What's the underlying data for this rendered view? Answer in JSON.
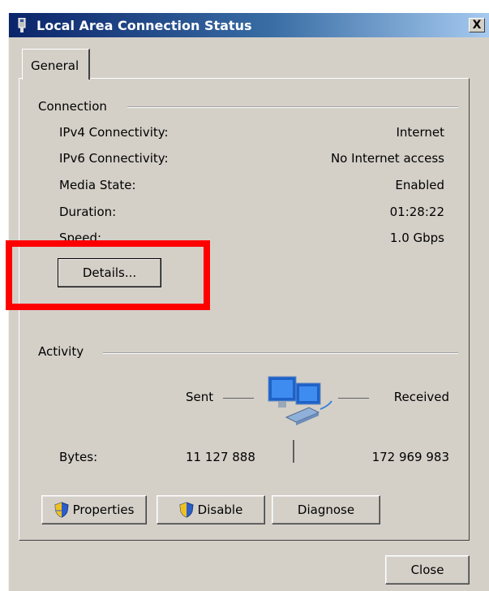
{
  "window": {
    "title": "Local Area Connection Status",
    "close_glyph": "X"
  },
  "tabs": [
    {
      "label": "General",
      "selected": true
    }
  ],
  "connection": {
    "group_label": "Connection",
    "rows": [
      {
        "label": "IPv4 Connectivity:",
        "value": "Internet"
      },
      {
        "label": "IPv6 Connectivity:",
        "value": "No Internet access"
      },
      {
        "label": "Media State:",
        "value": "Enabled"
      },
      {
        "label": "Duration:",
        "value": "01:28:22"
      },
      {
        "label": "Speed:",
        "value": "1.0 Gbps"
      }
    ],
    "details_button": "Details..."
  },
  "activity": {
    "group_label": "Activity",
    "sent_label": "Sent",
    "received_label": "Received",
    "bytes_label": "Bytes:",
    "bytes_sent": "11 127 888",
    "bytes_received": "172 969 983",
    "network_icon": "network-computers-icon"
  },
  "buttons": {
    "properties": "Properties",
    "disable": "Disable",
    "diagnose": "Diagnose",
    "close": "Close"
  },
  "colors": {
    "annotation_highlight": "#ff0000",
    "dialog_face": "#d4d0c8",
    "titlebar": "#0a246a"
  }
}
